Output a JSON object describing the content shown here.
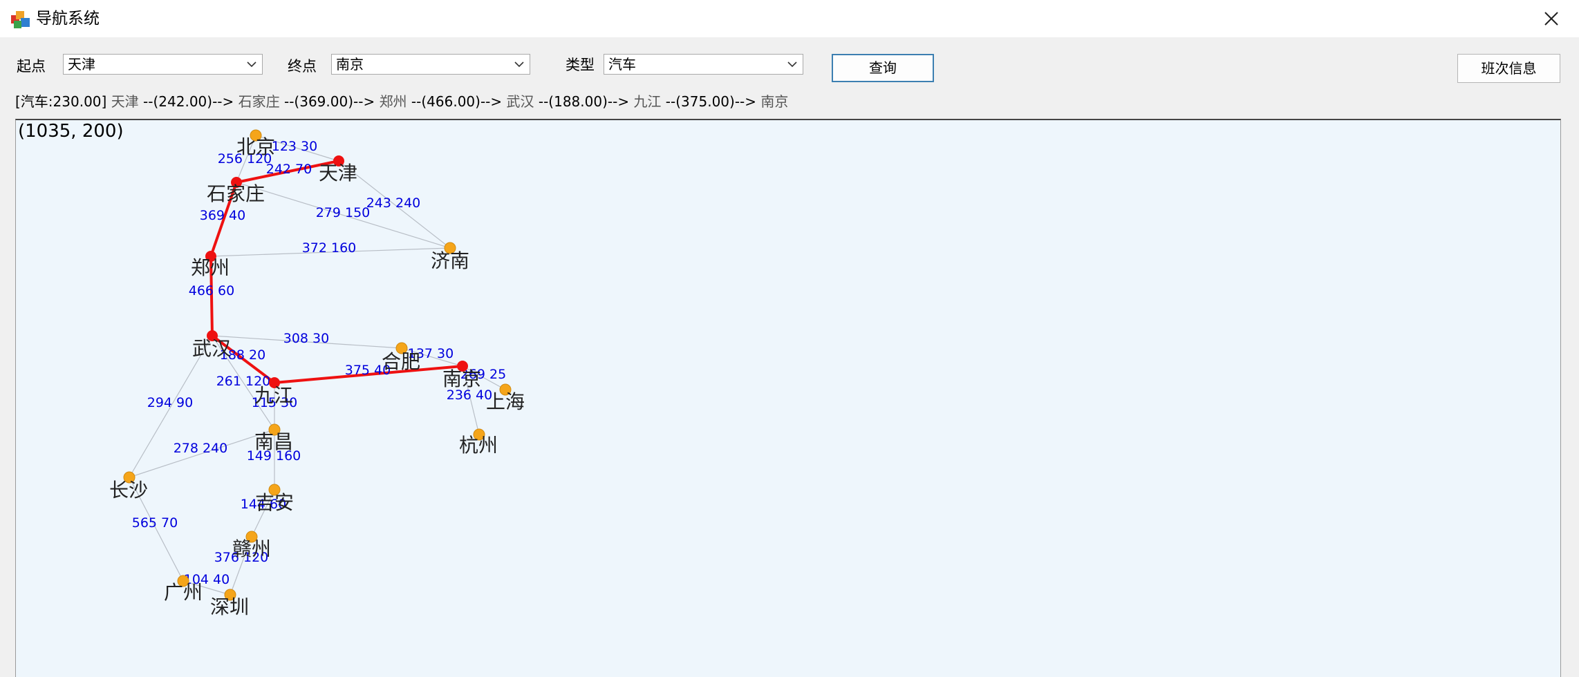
{
  "window": {
    "title": "导航系统",
    "app_icon": "app-icon",
    "close_icon": "close-icon"
  },
  "form": {
    "start_label": "起点",
    "start_value": "天津",
    "end_label": "终点",
    "end_value": "南京",
    "type_label": "类型",
    "type_value": "汽车",
    "query_button": "查询",
    "schedule_button": "班次信息"
  },
  "route": {
    "segments": [
      {
        "text": "[汽车:230.00]",
        "dark": true
      },
      {
        "text": "天津",
        "dark": false
      },
      {
        "text": "--(242.00)-->",
        "dark": true
      },
      {
        "text": "石家庄",
        "dark": false
      },
      {
        "text": "--(369.00)-->",
        "dark": true
      },
      {
        "text": "郑州",
        "dark": false
      },
      {
        "text": "--(466.00)-->",
        "dark": true
      },
      {
        "text": "武汉",
        "dark": false
      },
      {
        "text": "--(188.00)-->",
        "dark": true
      },
      {
        "text": "九江",
        "dark": false
      },
      {
        "text": "--(375.00)-->",
        "dark": true
      },
      {
        "text": "南京",
        "dark": false
      }
    ]
  },
  "map": {
    "coord_readout": "(1035, 200)",
    "colors": {
      "route": "#ee1111",
      "node": "#f5a51a",
      "route_node": "#ee1111",
      "edge": "#b8bec6",
      "edge_label": "#0000dd"
    },
    "cities": [
      {
        "name": "北京",
        "on_route": false
      },
      {
        "name": "天津",
        "on_route": true
      },
      {
        "name": "石家庄",
        "on_route": true
      },
      {
        "name": "济南",
        "on_route": false
      },
      {
        "name": "郑州",
        "on_route": true
      },
      {
        "name": "武汉",
        "on_route": true
      },
      {
        "name": "合肥",
        "on_route": false
      },
      {
        "name": "南京",
        "on_route": true
      },
      {
        "name": "上海",
        "on_route": false
      },
      {
        "name": "杭州",
        "on_route": false
      },
      {
        "name": "九江",
        "on_route": true
      },
      {
        "name": "南昌",
        "on_route": false
      },
      {
        "name": "长沙",
        "on_route": false
      },
      {
        "name": "吉安",
        "on_route": false
      },
      {
        "name": "赣州",
        "on_route": false
      },
      {
        "name": "广州",
        "on_route": false
      },
      {
        "name": "深圳",
        "on_route": false
      }
    ],
    "edges": [
      {
        "from": "北京",
        "to": "天津",
        "label": "123  30",
        "on_route": false
      },
      {
        "from": "北京",
        "to": "石家庄",
        "label": "256  120",
        "on_route": false
      },
      {
        "from": "天津",
        "to": "石家庄",
        "label": "242  70",
        "on_route": true
      },
      {
        "from": "天津",
        "to": "济南",
        "label": "243  240",
        "on_route": false
      },
      {
        "from": "石家庄",
        "to": "济南",
        "label": "279  150",
        "on_route": false
      },
      {
        "from": "石家庄",
        "to": "郑州",
        "label": "369  40",
        "on_route": true
      },
      {
        "from": "郑州",
        "to": "济南",
        "label": "372  160",
        "on_route": false
      },
      {
        "from": "郑州",
        "to": "武汉",
        "label": "466  60",
        "on_route": true
      },
      {
        "from": "武汉",
        "to": "合肥",
        "label": "308  30",
        "on_route": false
      },
      {
        "from": "武汉",
        "to": "九江",
        "label": "188  20",
        "on_route": true
      },
      {
        "from": "武汉",
        "to": "南昌",
        "label": "261  120",
        "on_route": false
      },
      {
        "from": "武汉",
        "to": "长沙",
        "label": "294  90",
        "on_route": false
      },
      {
        "from": "合肥",
        "to": "南京",
        "label": "137  30",
        "on_route": false
      },
      {
        "from": "九江",
        "to": "南京",
        "label": "375  40",
        "on_route": true
      },
      {
        "from": "南京",
        "to": "上海",
        "label": "269  25",
        "on_route": false
      },
      {
        "from": "南京",
        "to": "杭州",
        "label": "236  40",
        "on_route": false
      },
      {
        "from": "九江",
        "to": "南昌",
        "label": "115  30",
        "on_route": false
      },
      {
        "from": "南昌",
        "to": "长沙",
        "label": "278  240",
        "on_route": false
      },
      {
        "from": "南昌",
        "to": "吉安",
        "label": "149  160",
        "on_route": false
      },
      {
        "from": "吉安",
        "to": "赣州",
        "label": "144  60",
        "on_route": false
      },
      {
        "from": "长沙",
        "to": "广州",
        "label": "565  70",
        "on_route": false
      },
      {
        "from": "赣州",
        "to": "深圳",
        "label": "376  120",
        "on_route": false
      },
      {
        "from": "广州",
        "to": "深圳",
        "label": "104  40",
        "on_route": false
      }
    ]
  }
}
